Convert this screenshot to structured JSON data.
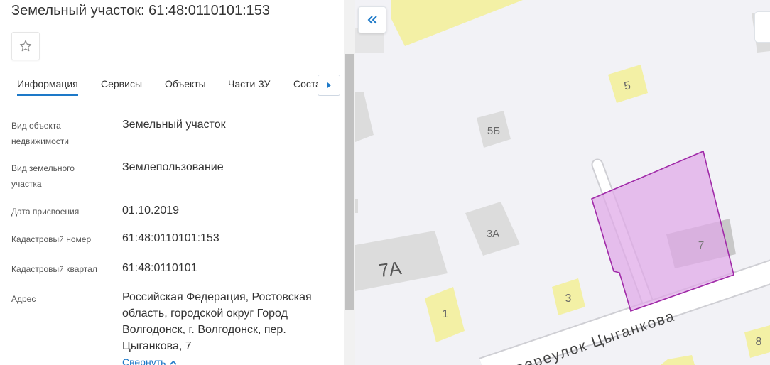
{
  "panel": {
    "title": "Земельный участок: 61:48:0110101:153",
    "tabs": [
      {
        "label": "Информация",
        "active": true
      },
      {
        "label": "Сервисы"
      },
      {
        "label": "Объекты"
      },
      {
        "label": "Части ЗУ"
      },
      {
        "label": "Соста"
      }
    ],
    "fields": [
      {
        "label": "Вид объекта недвижимости",
        "value": "Земельный участок"
      },
      {
        "label": "Вид земельного участка",
        "value": "Землепользование"
      },
      {
        "label": "Дата присвоения",
        "value": "01.10.2019"
      },
      {
        "label": "Кадастровый номер",
        "value": "61:48:0110101:153"
      },
      {
        "label": "Кадастровый квартал",
        "value": "61:48:0110101"
      },
      {
        "label": "Адрес",
        "value": "Российская Федерация, Ростовская область, городской округ Город Волгодонск, г. Волгодонск, пер. Цыганкова, 7"
      }
    ],
    "collapse_link": "Свернуть"
  },
  "map": {
    "house_numbers": [
      "5",
      "5Б",
      "3А",
      "7А",
      "7",
      "1",
      "3",
      "8"
    ],
    "street_name": "переулок Цыганкова",
    "colors": {
      "background": "#f2f2f6",
      "building_gray": "#dcdcdc",
      "building_yellow": "#f3f0a5",
      "parcel_fill": "#dfa8e8",
      "parcel_stroke": "#a02aa8",
      "accent": "#1d79c8"
    }
  }
}
